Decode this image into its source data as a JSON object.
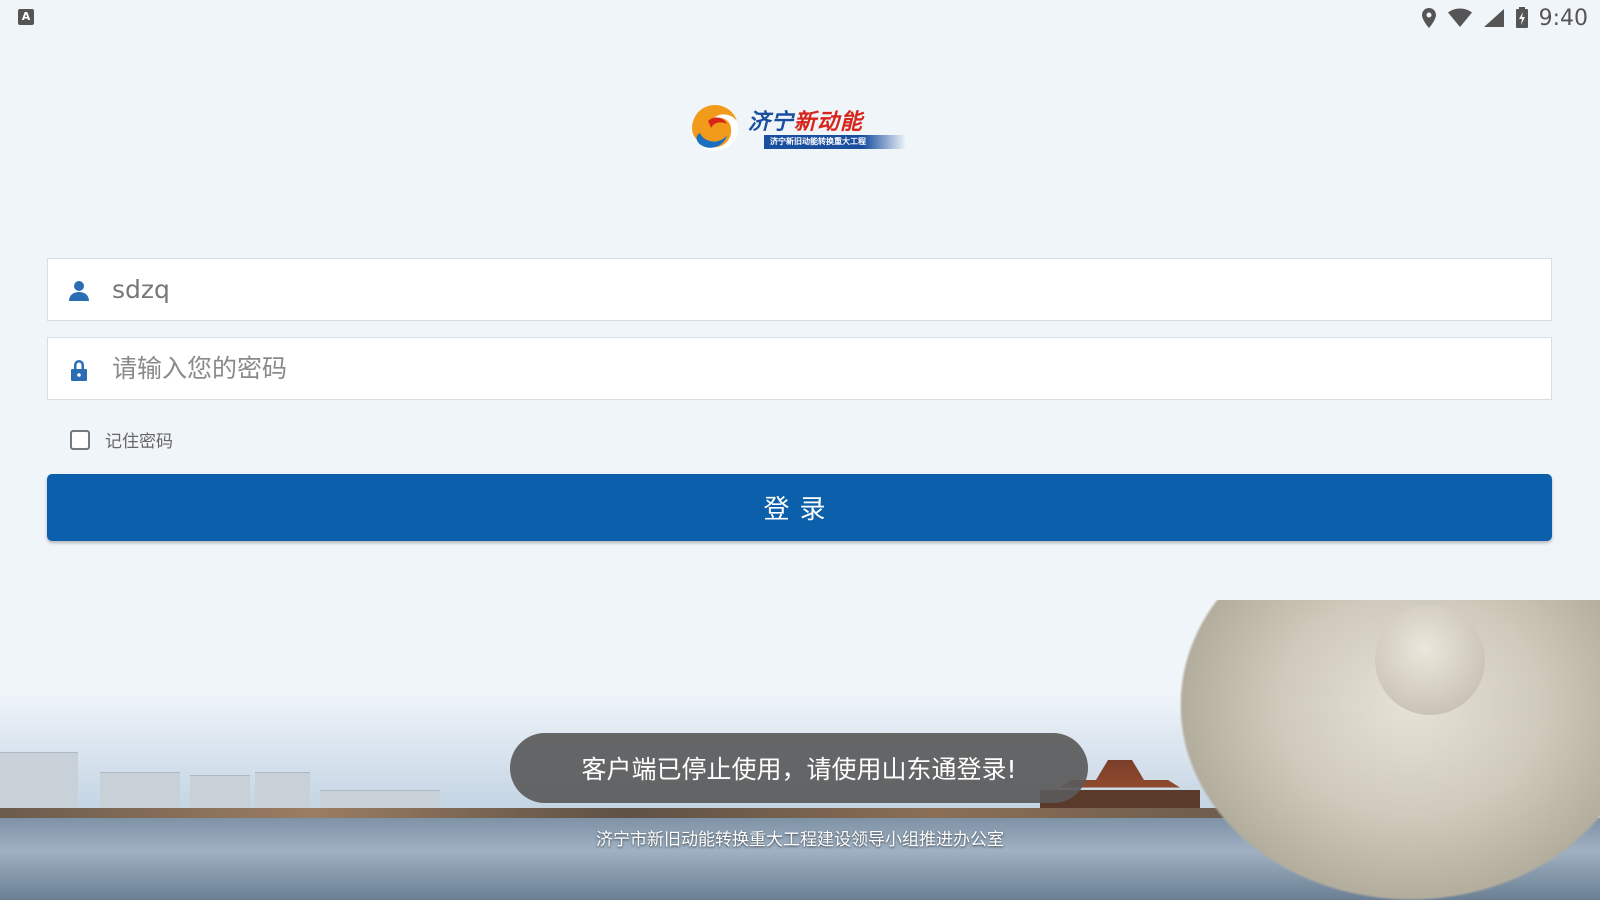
{
  "status_bar": {
    "left_icon": "A",
    "icons": [
      "location-icon",
      "wifi-icon",
      "signal-icon",
      "battery-icon"
    ],
    "time": "9:40"
  },
  "logo": {
    "title_blue": "济宁",
    "title_red": "新动能",
    "subtitle": "济宁新旧动能转换重大工程"
  },
  "login": {
    "username": {
      "value": "sdzq",
      "icon": "user-icon"
    },
    "password": {
      "placeholder": "请输入您的密码",
      "icon": "lock-icon"
    },
    "remember_label": "记住密码",
    "remember_checked": false,
    "button_label": "登录"
  },
  "toast": "客户端已停止使用，请使用山东通登录!",
  "footer": "济宁市新旧动能转换重大工程建设领导小组推进办公室",
  "colors": {
    "background": "#f0f5fa",
    "primary": "#0b5fab",
    "toast_bg": "#5a5a5a"
  }
}
